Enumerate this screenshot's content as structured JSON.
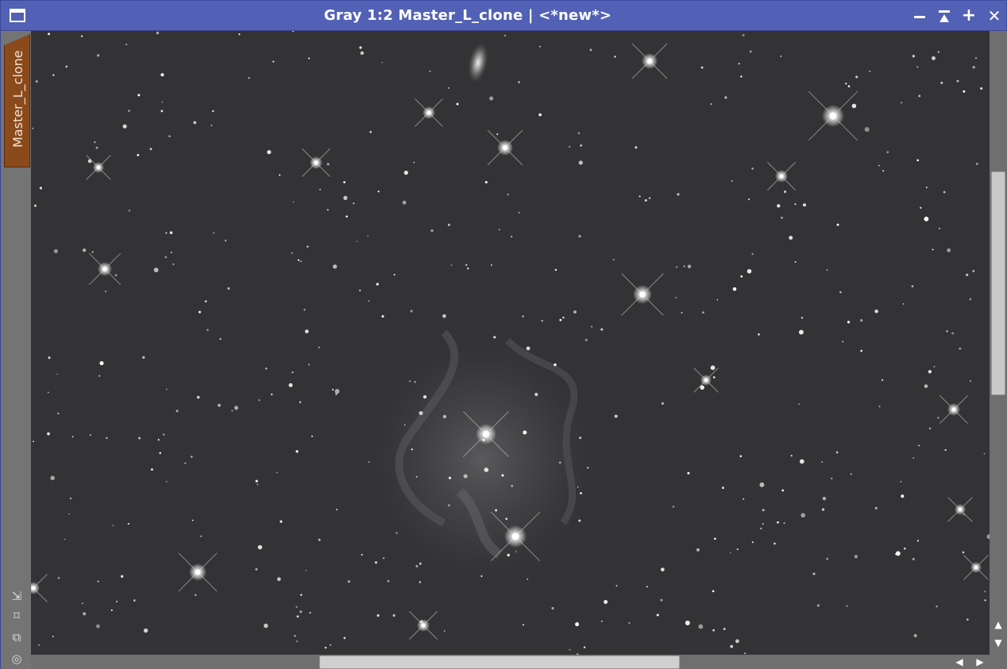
{
  "window": {
    "title": "Gray 1:2 Master_L_clone | <*new*>",
    "buttons": {
      "close_glyph": "✕",
      "maximize_glyph": "+"
    }
  },
  "view": {
    "tab_label": "Master_L_clone"
  },
  "side_tools": [
    {
      "icon": "fit-to-window-icon",
      "glyph": "⇲"
    },
    {
      "icon": "zoom-extents-icon",
      "glyph": "⌑"
    },
    {
      "icon": "clone-view-icon",
      "glyph": "⧉"
    },
    {
      "icon": "preview-target-icon",
      "glyph": "◎"
    }
  ],
  "scrollbars": {
    "up_glyph": "▲",
    "down_glyph": "▼",
    "left_glyph": "◀",
    "right_glyph": "▶"
  },
  "colors": {
    "titlebar": "#5261b5",
    "tab": "#8b4a1c",
    "sky": "#333335"
  }
}
